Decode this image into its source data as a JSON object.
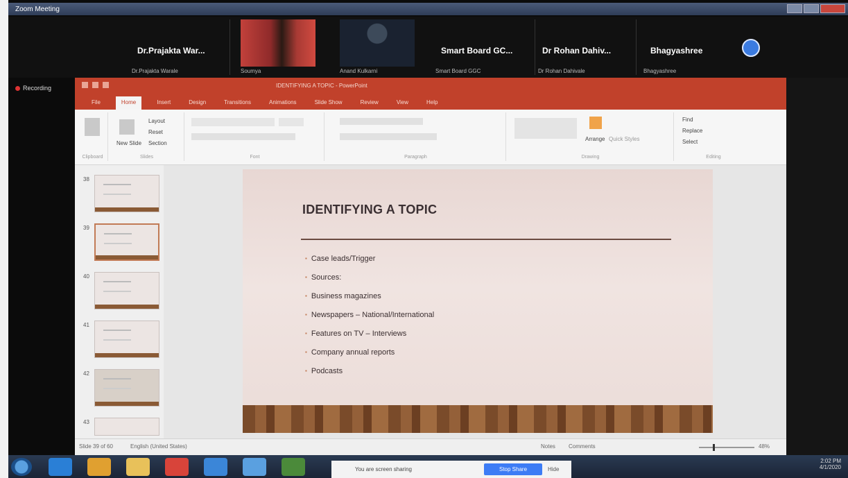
{
  "zoom": {
    "window_title": "Zoom Meeting",
    "participants": [
      {
        "name": "Dr.Prajakta War...",
        "sub": "Dr.Prajakta Warale"
      },
      {
        "name": "",
        "sub": "Soumya"
      },
      {
        "name": "",
        "sub": "Anand Kulkarni"
      },
      {
        "name": "Smart Board GC...",
        "sub": "Smart Board GGC"
      },
      {
        "name": "Dr Rohan Dahiv...",
        "sub": "Dr Rohan Dahivale"
      },
      {
        "name": "Bhagyashree",
        "sub": "Bhagyashree"
      }
    ],
    "recording_label": "Recording"
  },
  "ppt": {
    "title": "IDENTIFYING A TOPIC - PowerPoint",
    "tabs": [
      "File",
      "Home",
      "Insert",
      "Design",
      "Transitions",
      "Animations",
      "Slide Show",
      "Review",
      "View",
      "Help"
    ],
    "active_tab": "Home",
    "ribbon": {
      "groups": [
        "Clipboard",
        "Slides",
        "Font",
        "Paragraph",
        "Drawing",
        "Editing"
      ],
      "new_slide": "New Slide",
      "layout": "Layout",
      "reset": "Reset",
      "section": "Section",
      "arrange": "Arrange",
      "quick_styles": "Quick Styles",
      "find": "Find",
      "replace": "Replace",
      "select": "Select"
    },
    "slide_numbers": [
      "38",
      "39",
      "40",
      "41",
      "42",
      "43"
    ],
    "slide": {
      "title": "IDENTIFYING A TOPIC",
      "bullets": [
        "Case leads/Trigger",
        "Sources:",
        "Business magazines",
        "Newspapers – National/International",
        "Features on TV – Interviews",
        "Company annual reports",
        "Podcasts"
      ]
    },
    "status": {
      "slide_of": "Slide 39 of 60",
      "language": "English (United States)",
      "notes": "Notes",
      "comments": "Comments",
      "zoom": "48%"
    }
  },
  "taskbar": {
    "share_text": "You are screen sharing",
    "stop_share": "Stop Share",
    "hide": "Hide",
    "time": "2:02 PM",
    "date": "4/1/2020"
  }
}
